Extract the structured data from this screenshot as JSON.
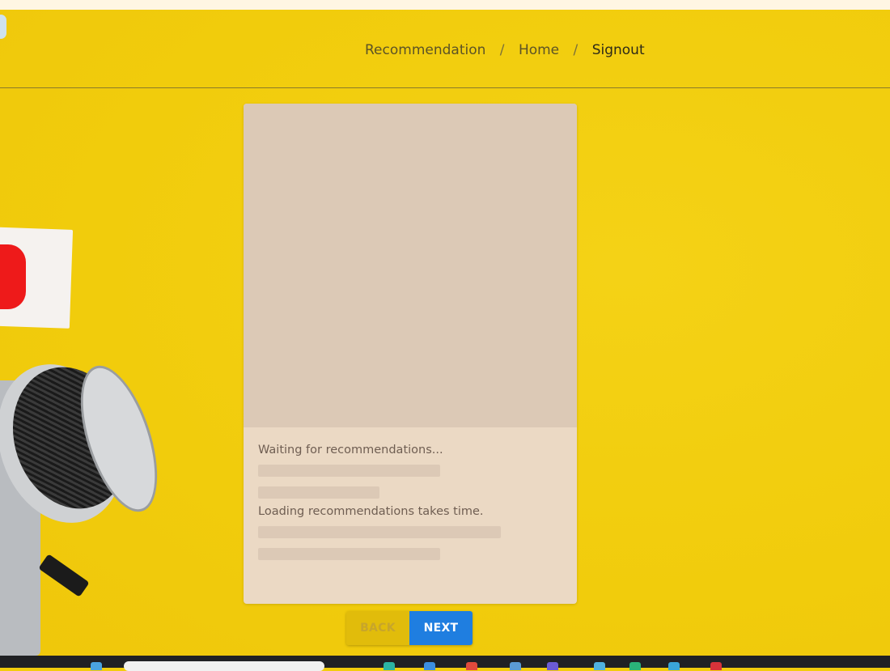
{
  "breadcrumb": {
    "items": [
      {
        "label": "Recommendation"
      },
      {
        "label": "Home"
      },
      {
        "label": "Signout"
      }
    ],
    "separator": "/"
  },
  "card": {
    "waiting_text": "Waiting for recommendations...",
    "loading_text": "Loading recommendations takes time."
  },
  "buttons": {
    "back_label": "BACK",
    "next_label": "NEXT"
  },
  "colors": {
    "background": "#f2cd0c",
    "next_button": "#1f7ee0",
    "card": "#ebd9c4"
  },
  "taskbar": {
    "icons": [
      "app-icon-1",
      "app-icon-2",
      "app-icon-3",
      "app-icon-4",
      "app-icon-5",
      "app-icon-6",
      "app-icon-7",
      "app-icon-8"
    ]
  }
}
